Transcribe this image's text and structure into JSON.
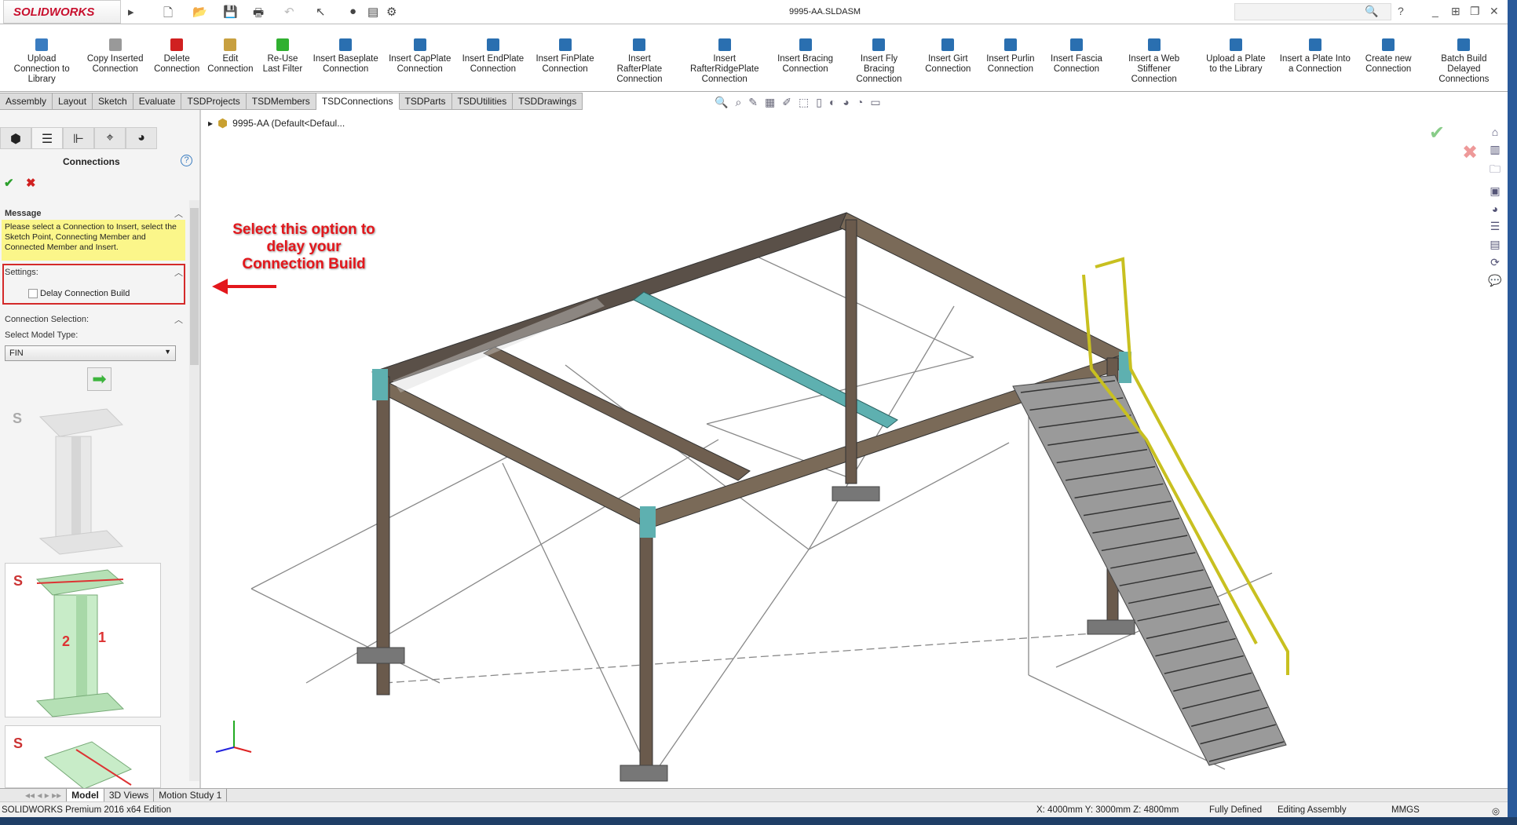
{
  "app": {
    "logo": "SOLIDWORKS",
    "document_title": "9995-AA.SLDASM"
  },
  "ribbon": [
    {
      "label": "Upload Connection to Library",
      "color": "#3a7cc0"
    },
    {
      "label": "Copy Inserted Connection",
      "color": "#999999"
    },
    {
      "label": "Delete Connection",
      "color": "#d02020"
    },
    {
      "label": "Edit Connection",
      "color": "#c8a040"
    },
    {
      "label": "Re-Use Last Filter",
      "color": "#30b030"
    },
    {
      "label": "Insert Baseplate Connection",
      "color": "#2a6fb0"
    },
    {
      "label": "Insert CapPlate Connection",
      "color": "#2a6fb0"
    },
    {
      "label": "Insert EndPlate Connection",
      "color": "#2a6fb0"
    },
    {
      "label": "Insert FinPlate Connection",
      "color": "#2a6fb0"
    },
    {
      "label": "Insert RafterPlate Connection",
      "color": "#2a6fb0"
    },
    {
      "label": "Insert RafterRidgePlate Connection",
      "color": "#2a6fb0"
    },
    {
      "label": "Insert Bracing Connection",
      "color": "#2a6fb0"
    },
    {
      "label": "Insert Fly Bracing Connection",
      "color": "#2a6fb0"
    },
    {
      "label": "Insert Girt Connection",
      "color": "#2a6fb0"
    },
    {
      "label": "Insert Purlin Connection",
      "color": "#2a6fb0"
    },
    {
      "label": "Insert Fascia Connection",
      "color": "#2a6fb0"
    },
    {
      "label": "Insert a Web Stiffener Connection",
      "color": "#2a6fb0"
    },
    {
      "label": "Upload a Plate to the Library",
      "color": "#2a6fb0"
    },
    {
      "label": "Insert a Plate Into a Connection",
      "color": "#2a6fb0"
    },
    {
      "label": "Create new Connection",
      "color": "#2a6fb0"
    },
    {
      "label": "Batch Build Delayed Connections",
      "color": "#2a6fb0"
    }
  ],
  "tabs": [
    "Assembly",
    "Layout",
    "Sketch",
    "Evaluate",
    "TSDProjects",
    "TSDMembers",
    "TSDConnections",
    "TSDParts",
    "TSDUtilities",
    "TSDDrawings"
  ],
  "active_tab": "TSDConnections",
  "panel": {
    "title": "Connections",
    "message_header": "Message",
    "message": "Please select a Connection to Insert, select the Sketch Point, Connecting Member and Connected Member and Insert.",
    "settings_header": "Settings:",
    "delay_label": "Delay Connection Build",
    "delay_checked": false,
    "selection_header": "Connection Selection:",
    "model_type_label": "Select Model Type:",
    "model_type_value": "FIN",
    "card_letter": "S"
  },
  "tree": {
    "root": "9995-AA  (Default<Defaul..."
  },
  "annotation": {
    "text_lines": [
      "Select this option to",
      "delay your",
      "Connection Build"
    ]
  },
  "bottom_tabs": [
    "Model",
    "3D Views",
    "Motion Study 1"
  ],
  "status": {
    "edition": "SOLIDWORKS Premium 2016 x64 Edition",
    "coords": "X: 4000mm Y: 3000mm Z: 4800mm",
    "state": "Fully Defined",
    "mode": "Editing Assembly",
    "units": "MMGS"
  }
}
